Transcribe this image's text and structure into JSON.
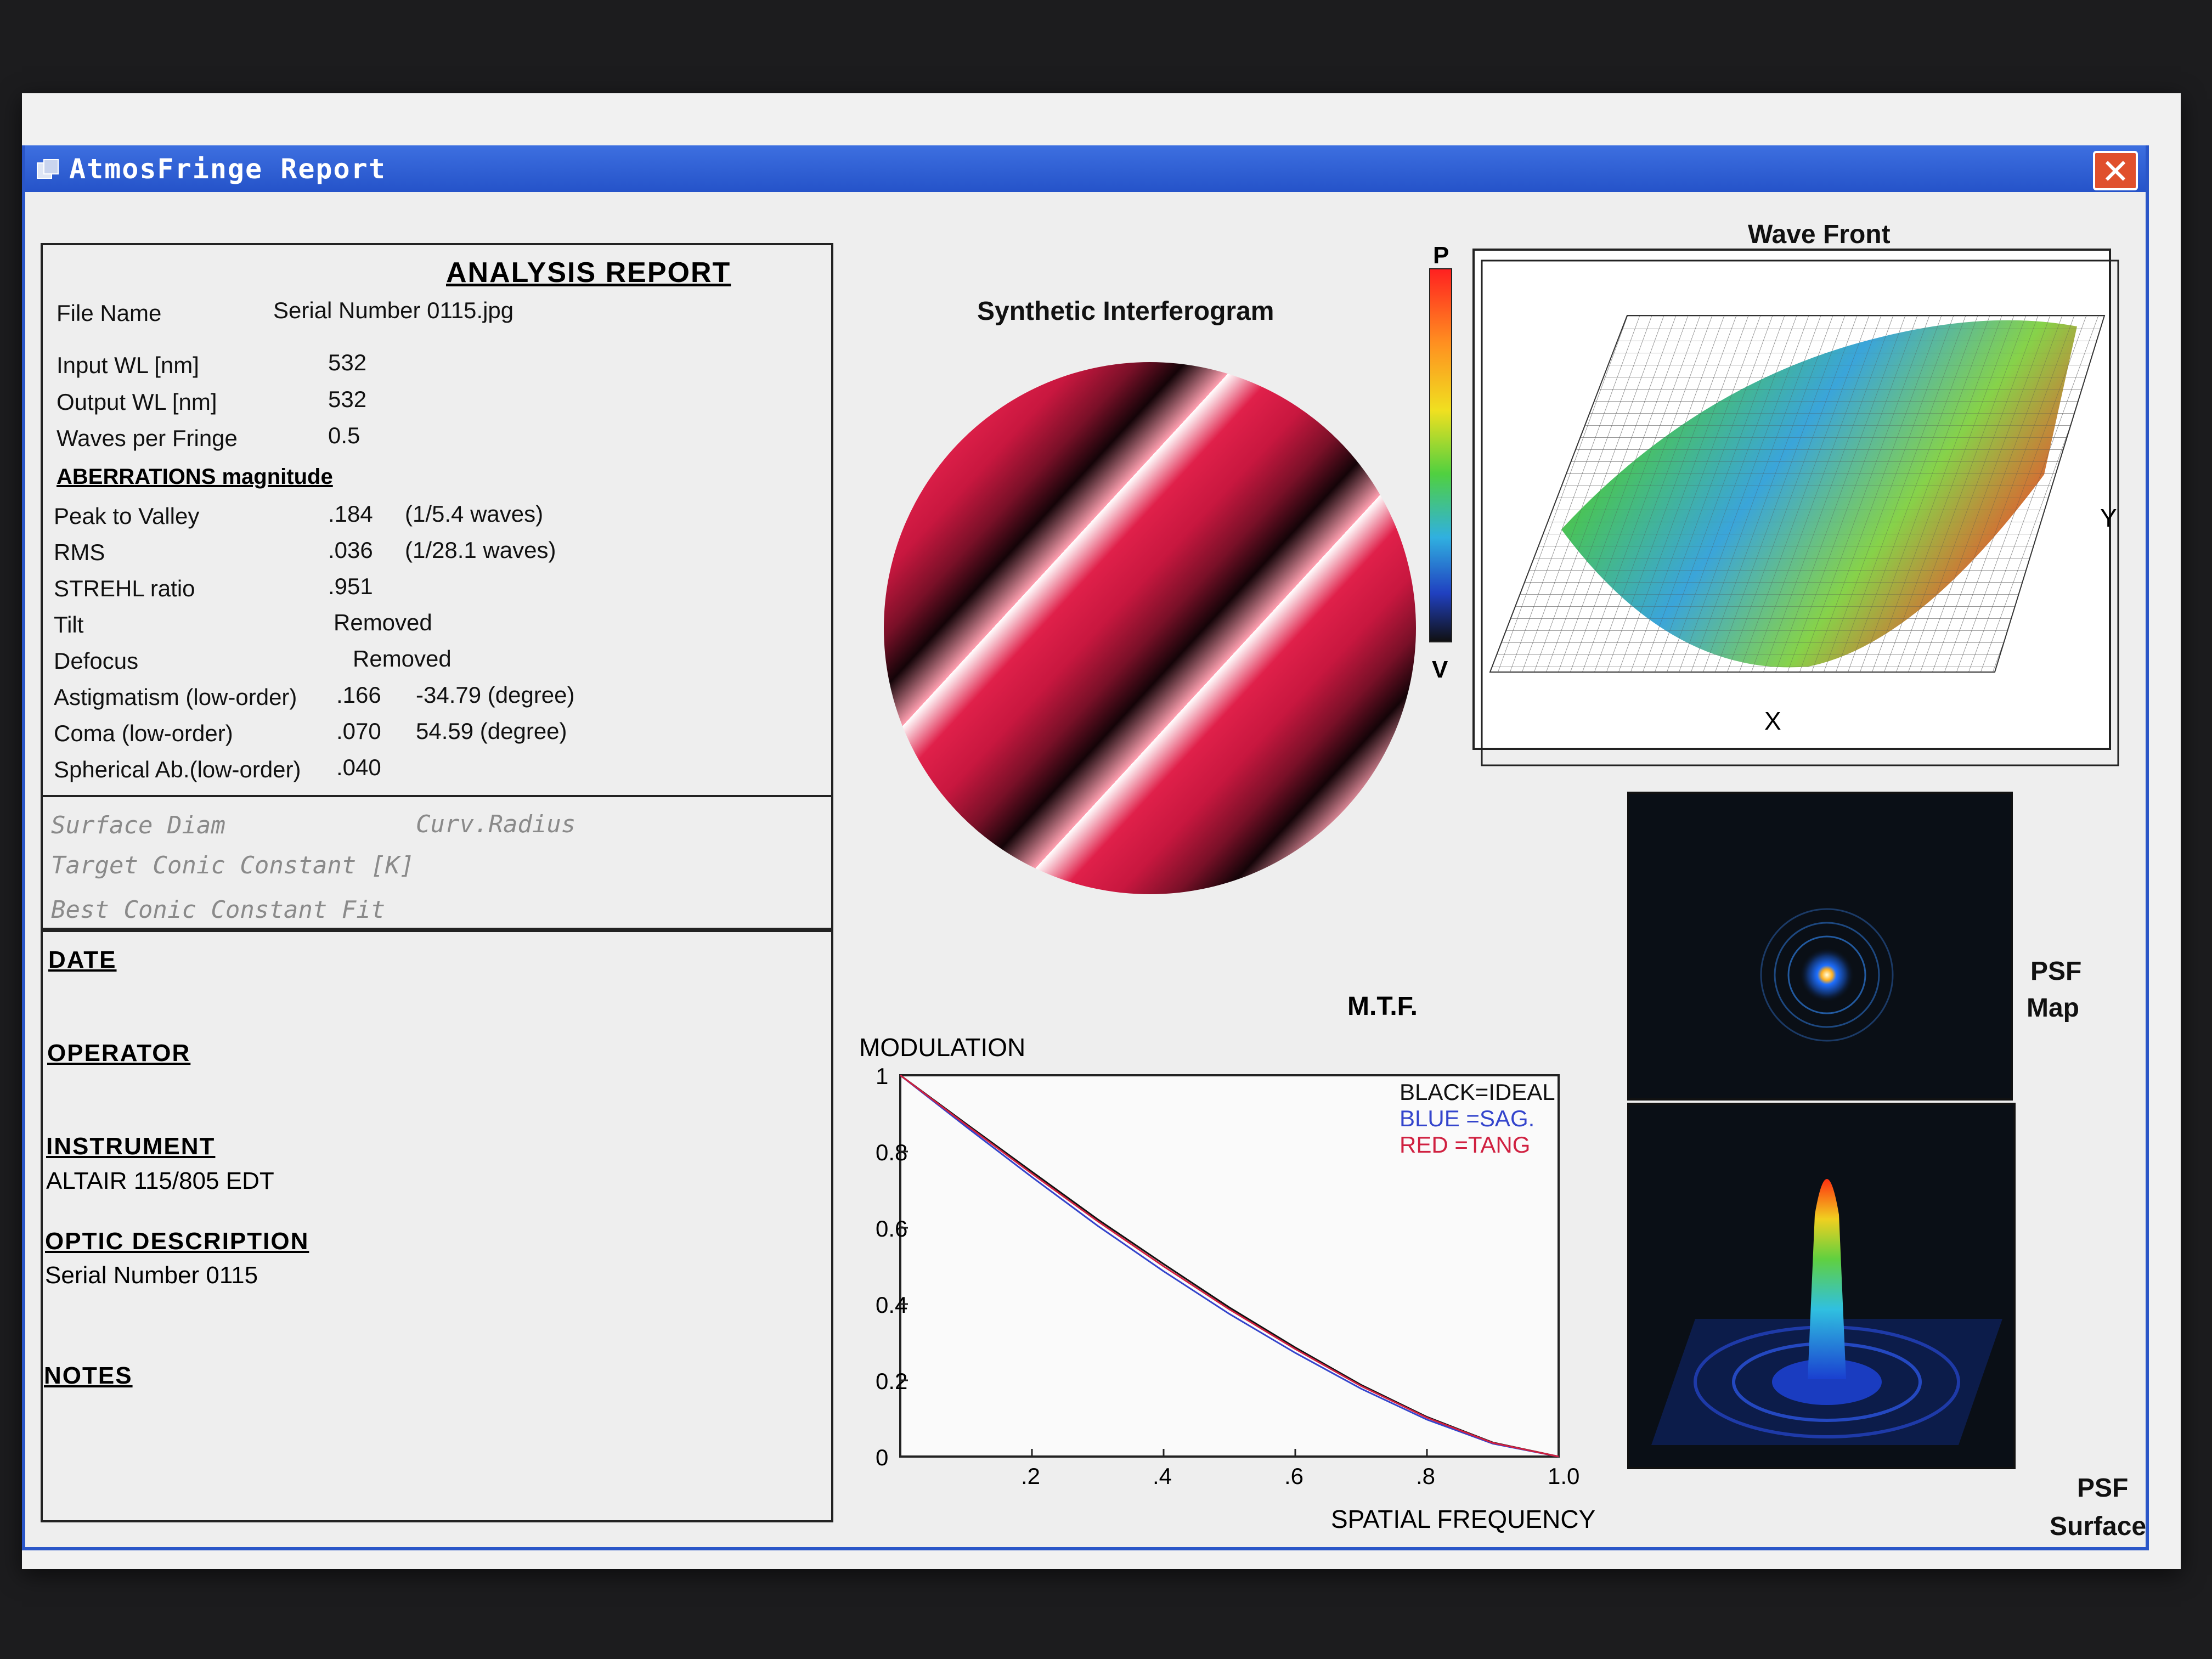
{
  "window": {
    "title": "AtmosFringe  Report",
    "close_label": "✕"
  },
  "analysis": {
    "title": "ANALYSIS  REPORT",
    "file_name_label": "File Name",
    "file_name": "Serial Number 0115.jpg",
    "input_wl_label": "Input  WL [nm]",
    "input_wl": "532",
    "output_wl_label": "Output WL [nm]",
    "output_wl": "532",
    "waves_label": "Waves per Fringe",
    "waves": "0.5",
    "aberr_heading": "ABERRATIONS magnitude",
    "rows": [
      {
        "label": "Peak to Valley",
        "value": ".184",
        "extra": "(1/5.4 waves)"
      },
      {
        "label": "RMS",
        "value": ".036",
        "extra": "(1/28.1 waves)"
      },
      {
        "label": "STREHL ratio",
        "value": ".951",
        "extra": ""
      },
      {
        "label": "Tilt",
        "value": "Removed",
        "extra": ""
      },
      {
        "label": "Defocus",
        "value": "Removed",
        "extra": ""
      },
      {
        "label": "Astigmatism  (low-order)",
        "value": ".166",
        "extra": "-34.79  (degree)"
      },
      {
        "label": "Coma          (low-order)",
        "value": ".070",
        "extra": "54.59  (degree)"
      },
      {
        "label": "Spherical Ab.(low-order)",
        "value": ".040",
        "extra": ""
      }
    ],
    "surface_diam": "Surface Diam",
    "curv_radius": "Curv.Radius",
    "target_conic": "Target Conic Constant [K]",
    "best_conic": "Best Conic Constant Fit"
  },
  "details": {
    "date_label": "DATE",
    "operator_label": "OPERATOR",
    "instrument_label": "INSTRUMENT",
    "instrument_value": "ALTAIR 115/805 EDT",
    "optic_label": "OPTIC DESCRIPTION",
    "optic_value": "Serial Number 0115",
    "notes_label": "NOTES"
  },
  "interferogram": {
    "title": "Synthetic Interferogram"
  },
  "wavefront": {
    "title": "Wave Front",
    "scale_top": "P",
    "scale_bottom": "V",
    "x_label": "X",
    "y_label": "Y"
  },
  "psf": {
    "map_label_1": "PSF",
    "map_label_2": "Map",
    "surface_label_1": "PSF",
    "surface_label_2": "Surface"
  },
  "chart_data": {
    "type": "line",
    "title": "M.T.F.",
    "ylabel": "MODULATION",
    "xlabel": "SPATIAL FREQUENCY",
    "xlim": [
      0,
      1.0
    ],
    "ylim": [
      0,
      1
    ],
    "x_ticks": [
      ".2",
      ".4",
      ".6",
      ".8",
      "1.0"
    ],
    "y_ticks": [
      "1",
      "0.8",
      "0.6",
      "0.4",
      "0.2",
      "0"
    ],
    "legend": [
      "BLACK=IDEAL",
      "BLUE  =SAG.",
      "RED    =TANG"
    ],
    "colors": {
      "ideal": "#111111",
      "sag": "#3344cc",
      "tang": "#d02040"
    },
    "x": [
      0,
      0.1,
      0.2,
      0.3,
      0.4,
      0.5,
      0.6,
      0.7,
      0.8,
      0.9,
      1.0
    ],
    "series": [
      {
        "name": "IDEAL",
        "values": [
          1.0,
          0.873,
          0.747,
          0.622,
          0.505,
          0.391,
          0.286,
          0.188,
          0.104,
          0.037,
          0.0
        ]
      },
      {
        "name": "SAG.",
        "values": [
          1.0,
          0.865,
          0.733,
          0.605,
          0.486,
          0.374,
          0.272,
          0.178,
          0.097,
          0.034,
          0.0
        ]
      },
      {
        "name": "TANG",
        "values": [
          1.0,
          0.87,
          0.742,
          0.617,
          0.499,
          0.386,
          0.282,
          0.185,
          0.102,
          0.036,
          0.0
        ]
      }
    ]
  }
}
